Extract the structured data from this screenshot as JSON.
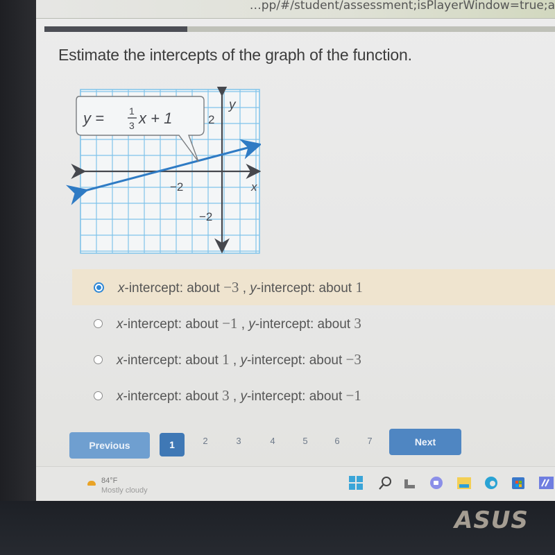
{
  "browser": {
    "url_text": "…pp/#/student/assessment;isPlayerWindow=true;a"
  },
  "progress": {
    "fraction": 0.28
  },
  "question": {
    "prompt": "Estimate the intercepts of the graph of the function."
  },
  "graph": {
    "equation_lhs": "y =",
    "equation_num": "1",
    "equation_den": "3",
    "equation_rhs": "x + 1",
    "x_axis_label": "x",
    "y_axis_label": "y",
    "x_tick_label": "−2",
    "y_tick_label_top": "2",
    "y_tick_label_bottom": "−2",
    "line_color": "#2f7bc4",
    "grid_color": "#7fc3ea"
  },
  "answers": [
    {
      "x_prefix": "x",
      "x_text": "-intercept: about ",
      "x_value": "−3",
      "y_prefix": "y",
      "y_text": "-intercept: about ",
      "y_value": "1",
      "selected": true
    },
    {
      "x_prefix": "x",
      "x_text": "-intercept: about ",
      "x_value": "−1",
      "y_prefix": "y",
      "y_text": "-intercept: about ",
      "y_value": "3",
      "selected": false
    },
    {
      "x_prefix": "x",
      "x_text": "-intercept: about ",
      "x_value": "1",
      "y_prefix": "y",
      "y_text": "-intercept: about ",
      "y_value": "−3",
      "selected": false
    },
    {
      "x_prefix": "x",
      "x_text": "-intercept: about ",
      "x_value": "3",
      "y_prefix": "y",
      "y_text": "-intercept: about ",
      "y_value": "−1",
      "selected": false
    }
  ],
  "separator": " , ",
  "pager": {
    "previous_label": "Previous",
    "next_label": "Next",
    "pages": [
      "1",
      "2",
      "3",
      "4",
      "5",
      "6",
      "7"
    ],
    "current_page": "1"
  },
  "taskbar": {
    "weather_temp": "84°F",
    "weather_desc": "Mostly cloudy",
    "icons": [
      "windows-start-icon",
      "search-icon",
      "widgets-icon",
      "chat-icon",
      "file-explorer-icon",
      "edge-browser-icon",
      "store-icon",
      "app-icon"
    ]
  },
  "hardware": {
    "brand": "ASUS"
  }
}
